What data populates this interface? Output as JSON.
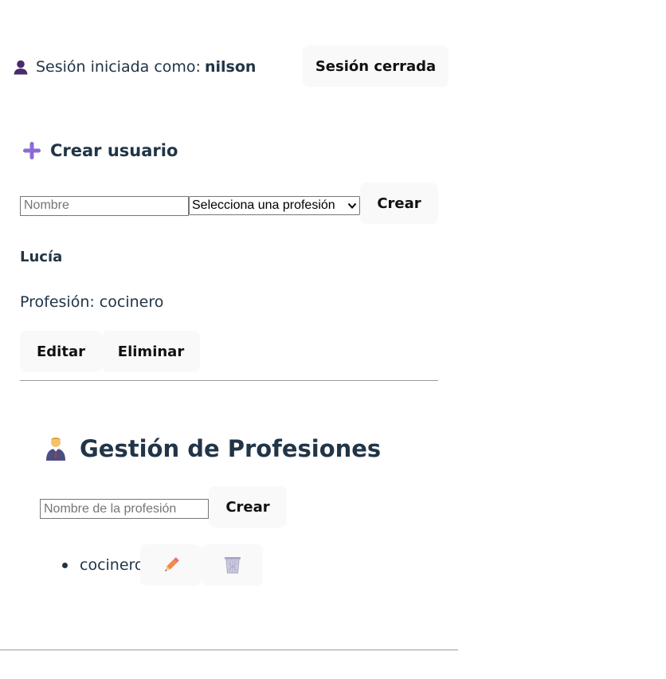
{
  "session": {
    "prefix": "Sesión iniciada como:",
    "username": "nilson",
    "icon": "user-icon",
    "logout_label": "Sesión cerrada"
  },
  "create_user": {
    "title": "Crear usuario",
    "icon": "plus-icon",
    "name_placeholder": "Nombre",
    "profession_select_value": "Selecciona una profesión",
    "create_label": "Crear"
  },
  "users": [
    {
      "name": "Lucía",
      "profession_text": "Profesión: cocinero",
      "edit_label": "Editar",
      "delete_label": "Eliminar"
    }
  ],
  "professions_section": {
    "title": "Gestión de Profesiones",
    "icon": "office-worker-icon",
    "name_placeholder": "Nombre de la profesión",
    "create_label": "Crear",
    "items": [
      {
        "name": "cocinero",
        "edit_icon": "pencil-icon",
        "delete_icon": "trash-icon"
      }
    ]
  },
  "colors": {
    "text": "#213547",
    "button_bg": "#f9f9f9",
    "plus_accent": "#8b6cd6",
    "user_icon": "#4b2a6b",
    "pencil": "#f08a4b"
  }
}
